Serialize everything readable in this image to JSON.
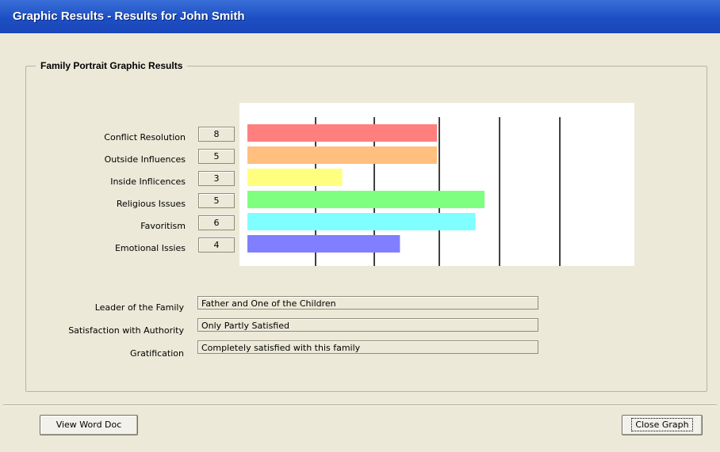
{
  "window": {
    "title": "Graphic Results - Results for John Smith"
  },
  "group": {
    "legend": "Family Portrait Graphic Results"
  },
  "chart_data": {
    "type": "bar",
    "orientation": "horizontal",
    "categories": [
      "Conflict Resolution",
      "Outside Influences",
      "Inside Inflicences",
      "Religious Issues",
      "Favoritism",
      "Emotional Issies"
    ],
    "values": [
      8,
      5,
      3,
      5,
      6,
      4
    ],
    "bar_fraction": [
      0.46,
      0.46,
      0.23,
      0.575,
      0.553,
      0.37
    ],
    "colors": [
      "#ff7f7f",
      "#ffbf7f",
      "#ffff7f",
      "#7fff7f",
      "#7fffff",
      "#7f7fff"
    ],
    "gridlines": 5
  },
  "scores": [
    {
      "label": "Conflict Resolution",
      "value": "8"
    },
    {
      "label": "Outside Influences",
      "value": "5"
    },
    {
      "label": "Inside Inflicences",
      "value": "3"
    },
    {
      "label": "Religious Issues",
      "value": "5"
    },
    {
      "label": "Favoritism",
      "value": "6"
    },
    {
      "label": "Emotional Issies",
      "value": "4"
    }
  ],
  "info": [
    {
      "label": "Leader of the Family",
      "value": "Father and One of the Children"
    },
    {
      "label": "Satisfaction with Authority",
      "value": "Only Partly Satisfied"
    },
    {
      "label": "Gratification",
      "value": "Completely satisfied with this family"
    }
  ],
  "buttons": {
    "view_word_doc": "View Word Doc",
    "close_graph": "Close Graph"
  }
}
